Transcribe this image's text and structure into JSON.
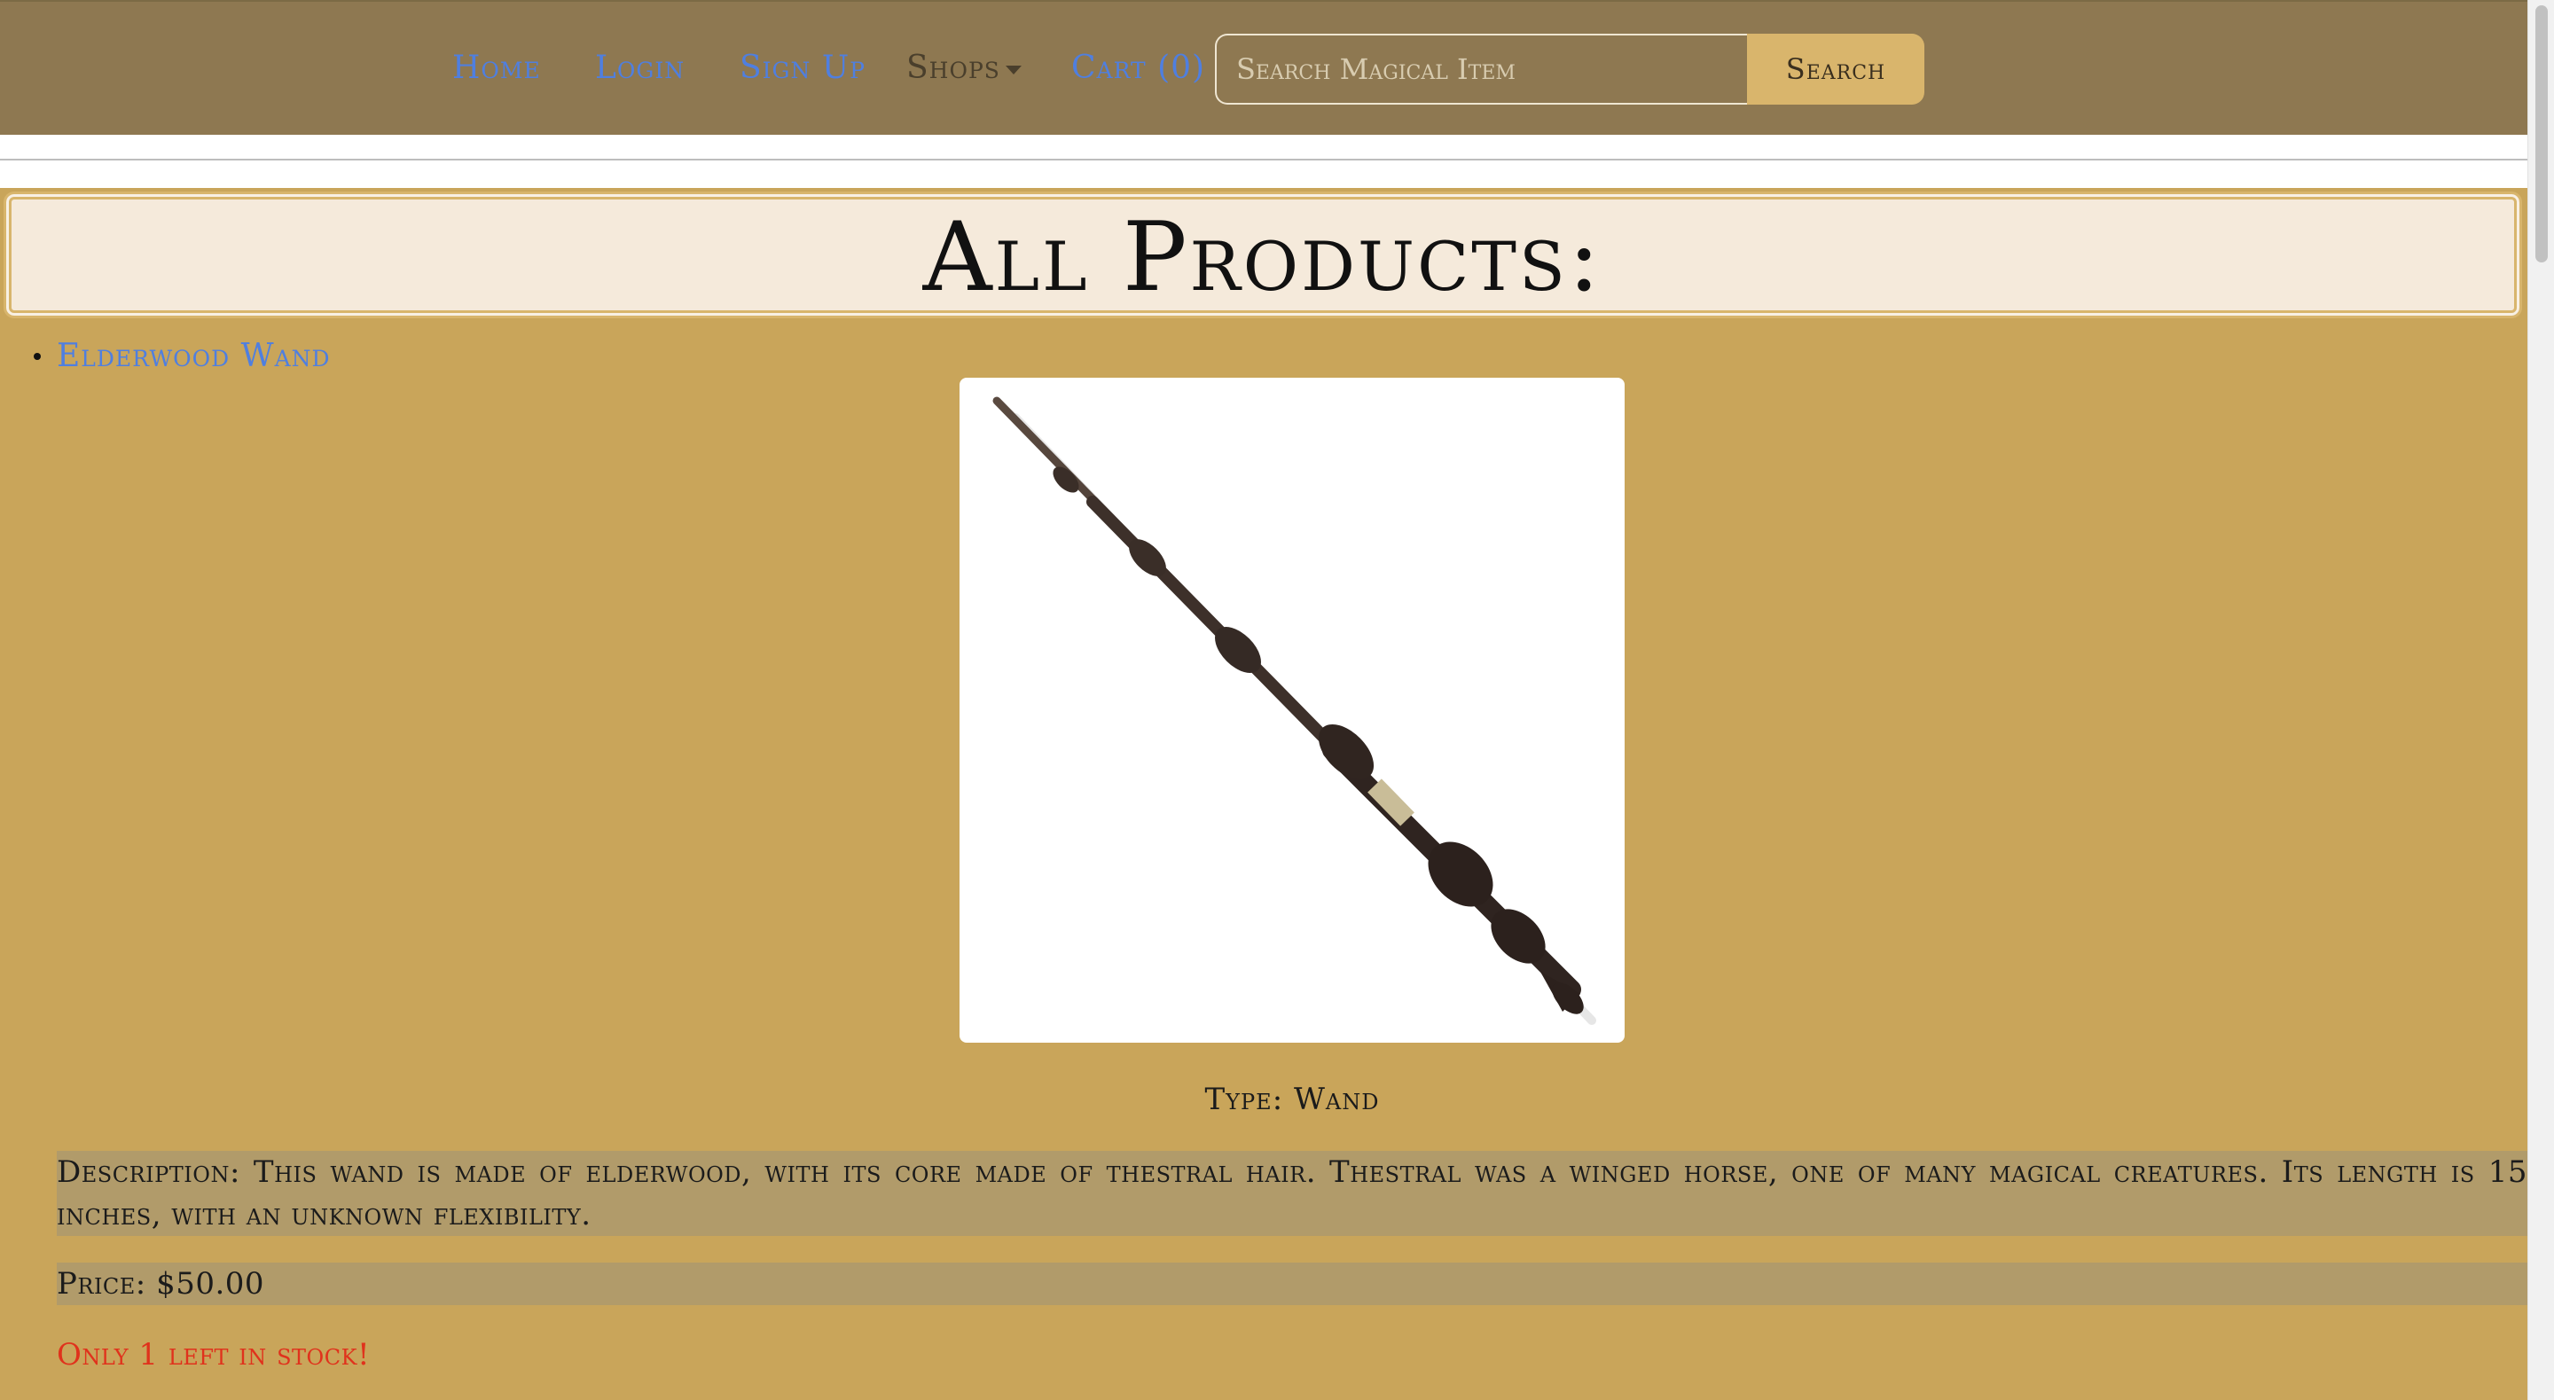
{
  "nav": {
    "home": "Home",
    "login": "Login",
    "signup": "Sign Up",
    "shops": "Shops",
    "cart": "Cart (0)",
    "search_placeholder": "Search Magical Item",
    "search_button": "Search"
  },
  "heading": "All Products:",
  "product": {
    "name": "Elderwood Wand",
    "type": "Type: Wand",
    "description": "Description: This wand is made of elderwood, with its core made of thestral hair. Thestral was a winged horse, one of many magical creatures. Its length is 15 inches, with an unknown flexibility.",
    "price": "Price: $50.00",
    "stock": "Only 1 left in stock!"
  },
  "colors": {
    "navbar": "#8e7851",
    "page_background": "#c9a55a",
    "link": "#4f7fe0",
    "stock_warning": "#e0321c",
    "highlight": "#b19b6a"
  },
  "icons": {
    "shops_dropdown": "caret-down-icon"
  }
}
